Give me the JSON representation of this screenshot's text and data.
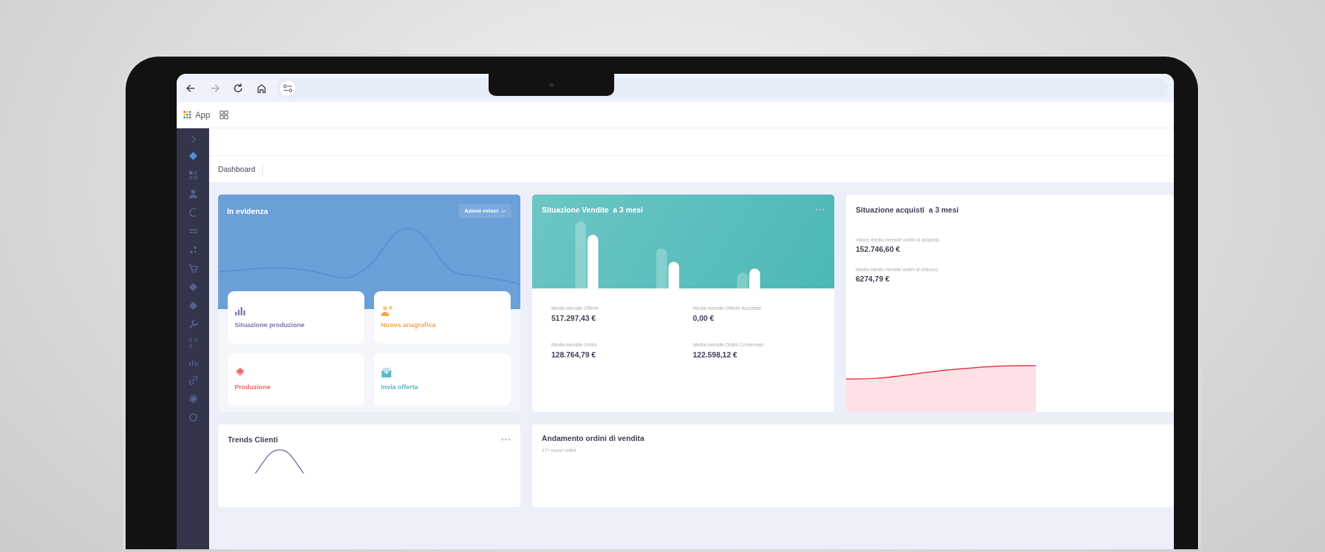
{
  "browser": {
    "nav_buttons": [
      {
        "kind": "back",
        "disabled": false
      },
      {
        "kind": "forward",
        "disabled": true
      },
      {
        "kind": "reload",
        "disabled": false
      },
      {
        "kind": "home",
        "disabled": false
      }
    ],
    "bookmarks": [
      {
        "kind": "apps",
        "label": "App"
      },
      {
        "kind": "grid"
      }
    ]
  },
  "sidebar": {
    "items": [
      {
        "selected": true
      },
      {
        "selected": false
      },
      {
        "selected": false
      },
      {
        "selected": false
      },
      {
        "selected": false
      },
      {
        "selected": false
      },
      {
        "selected": false
      },
      {
        "selected": false
      },
      {
        "selected": false
      },
      {
        "selected": false
      },
      {
        "selected": false
      },
      {
        "selected": false
      },
      {
        "selected": false
      },
      {
        "selected": false
      },
      {
        "selected": false
      }
    ]
  },
  "breadcrumb": [
    "Dashboard"
  ],
  "highlight_card": {
    "title": "In evidenza",
    "menu": "Azioni veloci",
    "tiles": [
      {
        "kind": "chart",
        "label": "Situazione produzione",
        "color": "#7a74ae"
      },
      {
        "kind": "user-add",
        "label": "Nuova anagrafica",
        "color": "#f3a646"
      },
      {
        "kind": "layers",
        "label": "Produzione",
        "color": "#ef6b6b"
      },
      {
        "kind": "send",
        "label": "Invia offerta",
        "color": "#5bb8c8"
      }
    ]
  },
  "sales_card": {
    "title": "Situazione Vendite  a 3 mesi",
    "stats": [
      {
        "label": "Media mensile Offerte",
        "value": "517.297,43 €"
      },
      {
        "label": "Media mensile Offerte Accettate",
        "value": "0,00 €"
      },
      {
        "label": "Media mensile Ordini",
        "value": "128.764,79 €"
      },
      {
        "label": "Media mensile Ordini Confermati",
        "value": "122.598,12 €"
      }
    ]
  },
  "purchases_card": {
    "title": "Situazione acquisti  a 3 mesi",
    "stats": [
      {
        "label": "Valore medio mensile ordini di acquisto",
        "value": "152.746,60 €"
      },
      {
        "label": "Media medio mensile ordini di c/lavoro",
        "value": "6274,79 €"
      }
    ]
  },
  "trends_card": {
    "title": "Trends Clienti"
  },
  "orders_card": {
    "title": "Andamento ordini di vendita",
    "subtitle": "17+ nuovi ordini"
  }
}
